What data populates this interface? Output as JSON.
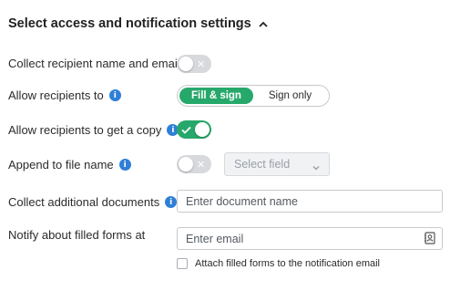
{
  "section": {
    "title": "Select access and notification settings"
  },
  "collect_name_email": {
    "label": "Collect recipient name and email",
    "enabled": false
  },
  "allow_recipients": {
    "label": "Allow recipients to",
    "options": [
      "Fill & sign",
      "Sign only"
    ],
    "selected": "Fill & sign"
  },
  "get_copy": {
    "label": "Allow recipients to get a copy",
    "enabled": true
  },
  "append_file_name": {
    "label": "Append to file name",
    "enabled": false,
    "select_placeholder": "Select field"
  },
  "additional_documents": {
    "label": "Collect additional documents",
    "placeholder": "Enter document name"
  },
  "notify": {
    "label": "Notify about filled forms at",
    "placeholder": "Enter email",
    "attach_label": "Attach filled forms to the notification email",
    "attach_checked": false
  },
  "colors": {
    "accent_green": "#27a86b",
    "info_blue": "#2f7fd6",
    "toggle_off": "#d7d9dd"
  },
  "icons": [
    "chevron-up-icon",
    "info-icon",
    "check-icon",
    "x-icon",
    "chevron-down-icon",
    "address-book-icon"
  ]
}
